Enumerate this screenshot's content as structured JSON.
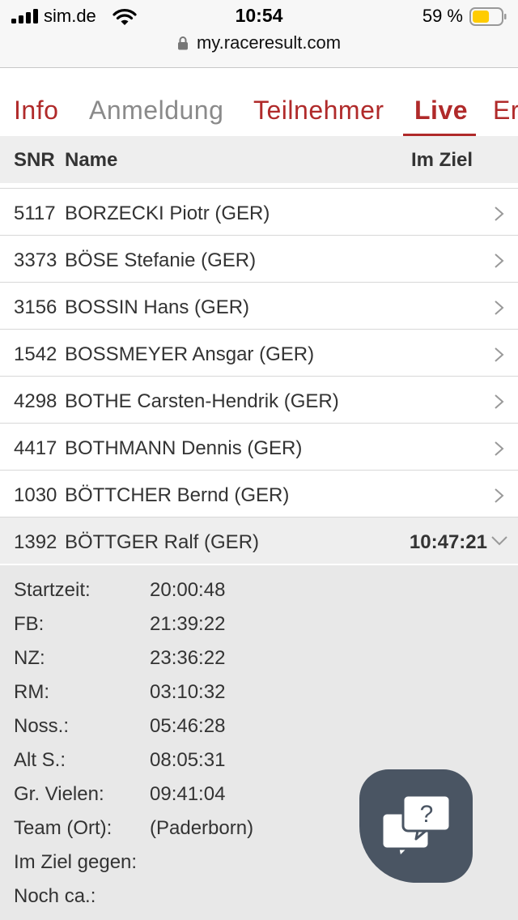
{
  "status_bar": {
    "carrier": "sim.de",
    "time": "10:54",
    "battery_percent": "59 %",
    "battery_level": 0.59,
    "battery_color": "#ffcc00"
  },
  "browser": {
    "url": "my.raceresult.com",
    "lock_icon": "lock-icon"
  },
  "tabs": [
    {
      "label": "Info",
      "state": "normal"
    },
    {
      "label": "Anmeldung",
      "state": "disabled"
    },
    {
      "label": "Teilnehmer",
      "state": "normal"
    },
    {
      "label": "Live",
      "state": "active"
    },
    {
      "label": "Er",
      "state": "normal"
    }
  ],
  "colors": {
    "accent": "#b02a2a",
    "header_bg": "#eeeeee",
    "help_bubble": "#4a5563"
  },
  "table": {
    "headers": {
      "snr": "SNR",
      "name": "Name",
      "finish": "Im Ziel"
    },
    "rows": [
      {
        "snr": "5117",
        "name": "BORZECKI Piotr (GER)"
      },
      {
        "snr": "3373",
        "name": "BÖSE Stefanie (GER)"
      },
      {
        "snr": "3156",
        "name": "BOSSIN Hans (GER)"
      },
      {
        "snr": "1542",
        "name": "BOSSMEYER Ansgar (GER)"
      },
      {
        "snr": "4298",
        "name": "BOTHE Carsten-Hendrik (GER)"
      },
      {
        "snr": "4417",
        "name": "BOTHMANN Dennis (GER)"
      },
      {
        "snr": "1030",
        "name": "BÖTTCHER Bernd (GER)"
      }
    ],
    "expanded_row": {
      "snr": "1392",
      "name": "BÖTTGER Ralf (GER)",
      "finish_time": "10:47:21"
    }
  },
  "detail": [
    {
      "label": "Startzeit:",
      "value": "20:00:48"
    },
    {
      "label": "FB:",
      "value": "21:39:22"
    },
    {
      "label": "NZ:",
      "value": "23:36:22"
    },
    {
      "label": "RM:",
      "value": "03:10:32"
    },
    {
      "label": "Noss.:",
      "value": "05:46:28"
    },
    {
      "label": "Alt S.:",
      "value": "08:05:31"
    },
    {
      "label": "Gr. Vielen:",
      "value": "09:41:04"
    },
    {
      "label": "Team (Ort):",
      "value": "(Paderborn)"
    },
    {
      "label": "Im Ziel gegen:",
      "value": ""
    },
    {
      "label": "Noch ca.:",
      "value": ""
    }
  ],
  "help_button": {
    "icon": "chat-question-icon",
    "glyph": "?"
  }
}
